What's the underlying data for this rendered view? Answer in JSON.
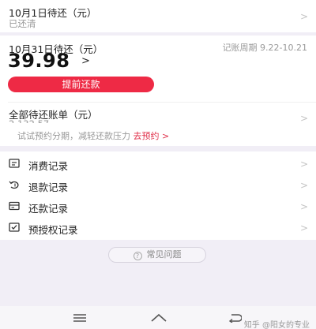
{
  "due_oct1": {
    "title": "10月1日待还（元）",
    "status": "已还清"
  },
  "due_oct31": {
    "title": "10月31日待还（元）",
    "amount": "39.98",
    "arrow": ">",
    "cycle": "记账周期 9.22-10.21",
    "repay_button": "提前还款"
  },
  "all_bills": {
    "title": "全部待还账单（元）",
    "amount": "2,132.57"
  },
  "promo": {
    "text": "试试预约分期，减轻还款压力",
    "link": "去预约 >"
  },
  "menu": [
    {
      "label": "消费记录",
      "icon": "bill-icon"
    },
    {
      "label": "退款记录",
      "icon": "refund-icon"
    },
    {
      "label": "还款记录",
      "icon": "card-icon"
    },
    {
      "label": "预授权记录",
      "icon": "checkbox-icon"
    }
  ],
  "faq": {
    "label": "常见问题",
    "icon": "question-icon"
  },
  "watermark": "知乎 @阳女的专业",
  "chevron": ">",
  "colors": {
    "accent": "#ee2a45",
    "background": "#f1eef6"
  }
}
